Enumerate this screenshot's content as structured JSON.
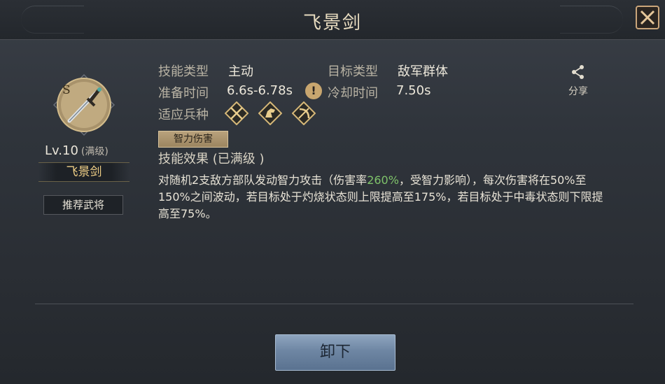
{
  "header": {
    "title": "飞景剑"
  },
  "skill": {
    "grade_letter": "S",
    "level": "Lv.10",
    "level_note": "(满级)",
    "name": "飞景剑",
    "recommend_label": "推荐武将"
  },
  "info": {
    "skill_type_label": "技能类型",
    "skill_type_value": "主动",
    "target_type_label": "目标类型",
    "target_type_value": "敌军群体",
    "prep_time_label": "准备时间",
    "prep_time_value": "6.6s-6.78s",
    "cooldown_label": "冷却时间",
    "cooldown_value": "7.50s",
    "troop_label": "适应兵种",
    "troop_icons": [
      "spear-infantry-icon",
      "cavalry-icon",
      "archer-icon"
    ]
  },
  "share_label": "分享",
  "damage_tag": "智力伤害",
  "effect": {
    "title": "技能效果 (已满级 )",
    "desc_part1": "对随机2支敌方部队发动智力攻击（伤害率",
    "desc_highlight": "260%",
    "desc_part2": "，受智力影响），每次伤害将在50%至150%之间波动，若目标处于灼烧状态则上限提高至175%，若目标处于中毒状态则下限提高至75%。"
  },
  "unload_label": "卸下",
  "colors": {
    "highlight": "#7fc36a",
    "gold": "#f0cf86",
    "button_blue": "#6e86a3"
  }
}
